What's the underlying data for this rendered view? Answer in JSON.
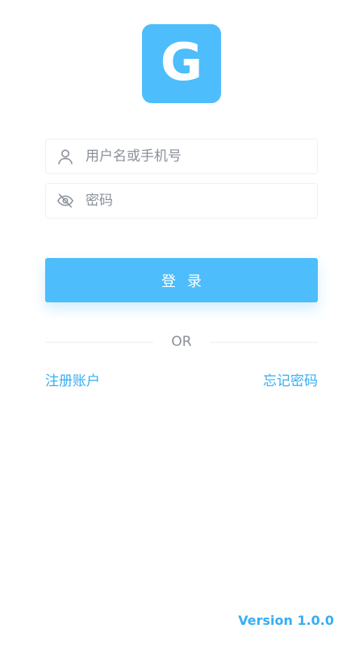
{
  "app": {
    "logo_letter": "G",
    "logo_color": "#4dbdfb"
  },
  "form": {
    "username": {
      "value": "",
      "placeholder": "用户名或手机号",
      "icon": "user-icon"
    },
    "password": {
      "value": "",
      "placeholder": "密码",
      "icon": "eye-off-icon"
    },
    "login_label": "登录"
  },
  "divider": {
    "label": "OR"
  },
  "links": {
    "register": "注册账户",
    "forgot": "忘记密码"
  },
  "footer": {
    "version": "Version 1.0.0"
  },
  "colors": {
    "primary": "#4dbdfb",
    "link": "#36aef5",
    "placeholder": "#8a8f99",
    "border": "#eef0f4"
  }
}
